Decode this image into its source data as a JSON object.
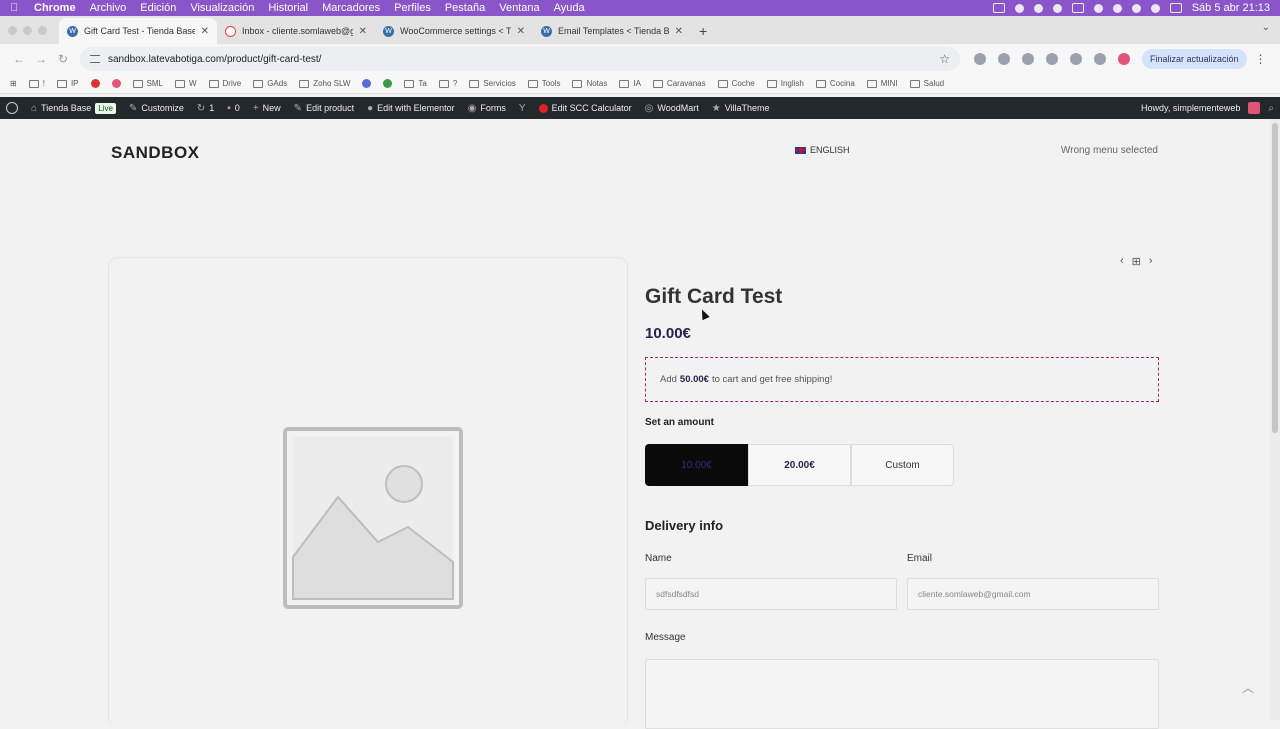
{
  "mac_menubar": {
    "items": [
      "Chrome",
      "Archivo",
      "Edición",
      "Visualización",
      "Historial",
      "Marcadores",
      "Perfiles",
      "Pestaña",
      "Ventana",
      "Ayuda"
    ],
    "clock": "Sáb 5 abr 21:13"
  },
  "browser": {
    "tabs": [
      {
        "title": "Gift Card Test - Tienda Base",
        "active": true
      },
      {
        "title": "Inbox - cliente.somlaweb@gm",
        "active": false
      },
      {
        "title": "WooCommerce settings < Tie",
        "active": false
      },
      {
        "title": "Email Templates < Tienda Bas",
        "active": false
      }
    ],
    "url": "sandbox.latevabotiga.com/product/gift-card-test/",
    "update_button": "Finalizar actualización",
    "bookmarks": [
      "!",
      "IP",
      "SML",
      "W",
      "Drive",
      "GAds",
      "Zoho SLW",
      "Ta",
      "?",
      "Servicios",
      "Tools",
      "Notas",
      "IA",
      "Caravanas",
      "Coche",
      "Inglish",
      "Cocina",
      "MINI",
      "Salud"
    ]
  },
  "wp_admin_bar": {
    "site_name": "Tienda Base",
    "live_badge": "Live",
    "customize": "Customize",
    "updates_count": "1",
    "comments_count": "0",
    "new": "New",
    "edit_product": "Edit product",
    "edit_elementor": "Edit with Elementor",
    "forms": "Forms",
    "scc": "Edit SCC Calculator",
    "woodmart": "WoodMart",
    "villatheme": "VillaTheme",
    "howdy": "Howdy, simplementeweb"
  },
  "site": {
    "logo": "SANDBOX",
    "language": "ENGLISH",
    "menu_notice": "Wrong menu selected"
  },
  "product": {
    "title": "Gift Card Test",
    "price": "10.00€",
    "shipping_prefix": "Add",
    "shipping_amount": "50.00€",
    "shipping_suffix": "to cart and get free shipping!",
    "amount_label": "Set an amount",
    "amounts": [
      "10.00€",
      "20.00€",
      "Custom"
    ],
    "selected_amount": "10.00€",
    "delivery_heading": "Delivery info",
    "name_label": "Name",
    "name_value": "sdfsdfsdfsd",
    "email_label": "Email",
    "email_value": "cliente.somlaweb@gmail.com",
    "message_label": "Message"
  },
  "colors": {
    "accent": "#2a1e4d",
    "dashed_border": "#a0287a",
    "wp_bar": "#23282d",
    "mac_bar": "#8a55c8"
  }
}
